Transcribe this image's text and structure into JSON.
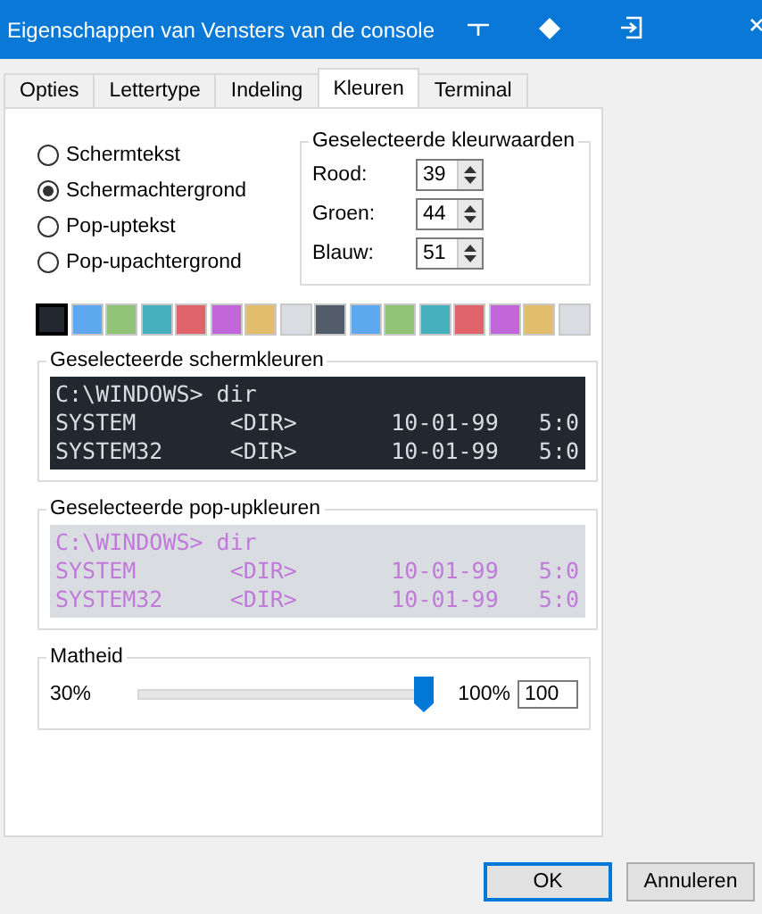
{
  "window": {
    "title": "Eigenschappen van Vensters van de console"
  },
  "tabs": [
    {
      "label": "Opties",
      "selected": false
    },
    {
      "label": "Lettertype",
      "selected": false
    },
    {
      "label": "Indeling",
      "selected": false
    },
    {
      "label": "Kleuren",
      "selected": true
    },
    {
      "label": "Terminal",
      "selected": false
    }
  ],
  "color_targets": [
    {
      "label": "Schermtekst",
      "selected": false
    },
    {
      "label": "Schermachtergrond",
      "selected": true
    },
    {
      "label": "Pop-uptekst",
      "selected": false
    },
    {
      "label": "Pop-upachtergrond",
      "selected": false
    }
  ],
  "color_values": {
    "title": "Geselecteerde kleurwaarden",
    "fields": [
      {
        "label": "Rood:",
        "value": "39"
      },
      {
        "label": "Groen:",
        "value": "44"
      },
      {
        "label": "Blauw:",
        "value": "51"
      }
    ]
  },
  "palette": [
    {
      "color": "#232830",
      "selected": true
    },
    {
      "color": "#5ea8ef",
      "selected": false
    },
    {
      "color": "#91c378",
      "selected": false
    },
    {
      "color": "#46b0bd",
      "selected": false
    },
    {
      "color": "#e0626b",
      "selected": false
    },
    {
      "color": "#c066d8",
      "selected": false
    },
    {
      "color": "#e2bd6c",
      "selected": false
    },
    {
      "color": "#d9dde2",
      "selected": false
    },
    {
      "color": "#535c6b",
      "selected": false
    },
    {
      "color": "#5ea8ef",
      "selected": false
    },
    {
      "color": "#91c378",
      "selected": false
    },
    {
      "color": "#46b0bd",
      "selected": false
    },
    {
      "color": "#e0626b",
      "selected": false
    },
    {
      "color": "#c066d8",
      "selected": false
    },
    {
      "color": "#e2bd6c",
      "selected": false
    },
    {
      "color": "#d9dde2",
      "selected": false
    }
  ],
  "screen_colors": {
    "title": "Geselecteerde schermkleuren",
    "lines": [
      "C:\\WINDOWS> dir",
      "SYSTEM       <DIR>       10-01-99   5:0",
      "SYSTEM32     <DIR>       10-01-99   5:0"
    ]
  },
  "popup_colors": {
    "title": "Geselecteerde pop-upkleuren",
    "lines": [
      "C:\\WINDOWS> dir",
      "SYSTEM       <DIR>       10-01-99   5:0",
      "SYSTEM32     <DIR>       10-01-99   5:0"
    ]
  },
  "opacity": {
    "title": "Matheid",
    "min_label": "30%",
    "max_label": "100%",
    "level": 1,
    "value": "100"
  },
  "buttons": [
    {
      "label": "OK",
      "default": true
    },
    {
      "label": "Annuleren",
      "default": false
    }
  ]
}
